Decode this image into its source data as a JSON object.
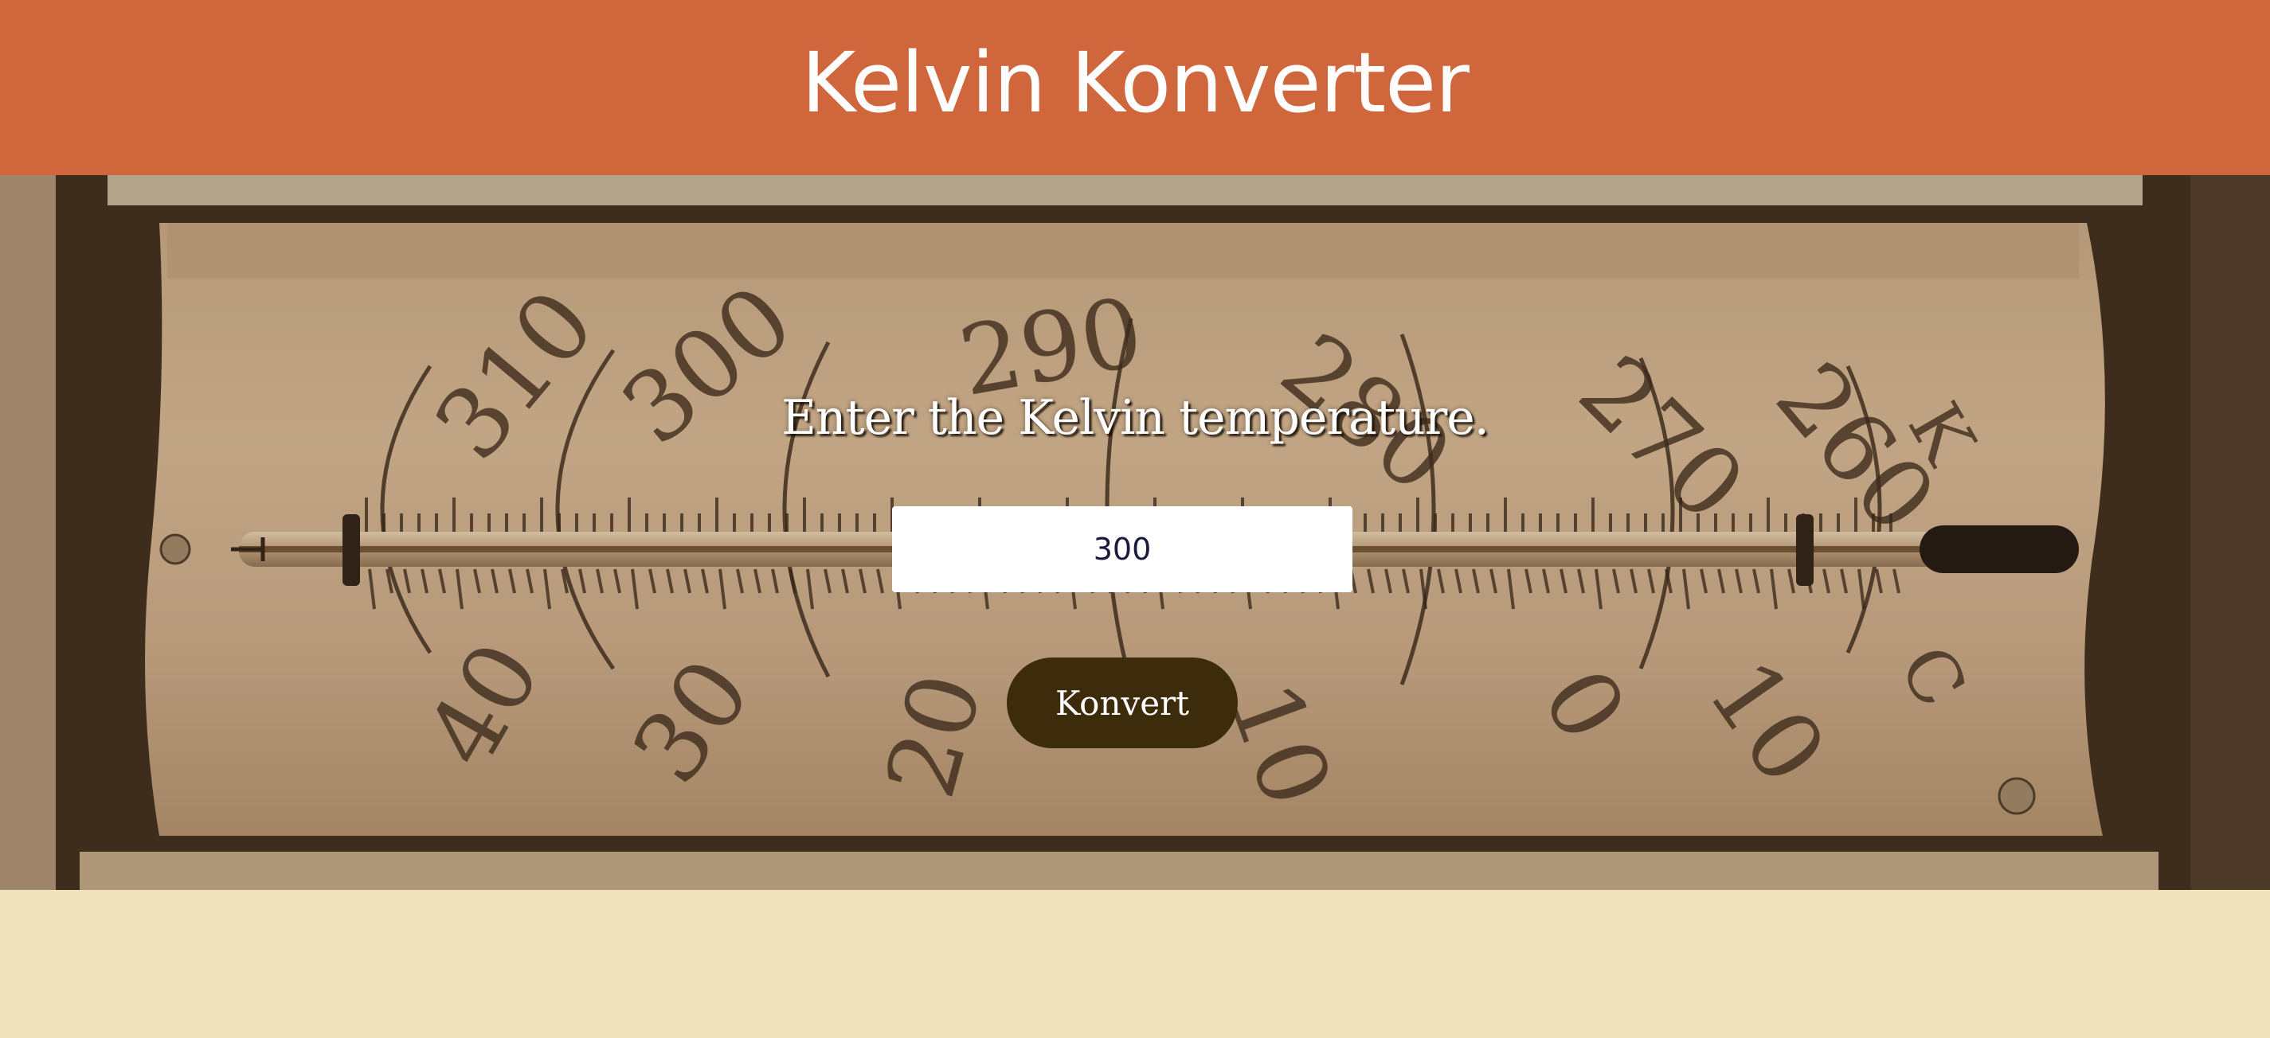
{
  "app": {
    "title": "Kelvin Konverter"
  },
  "form": {
    "prompt": "Enter the Kelvin temperature.",
    "input_value": "300",
    "button_label": "Konvert"
  },
  "thermometer_image": {
    "kelvin_labels": [
      "310",
      "300",
      "290",
      "280",
      "270",
      "260",
      "K"
    ],
    "celsius_labels": [
      "40",
      "30",
      "20",
      "10",
      "0",
      "-10",
      "C"
    ]
  },
  "colors": {
    "header_bg": "#d0663b",
    "page_bg": "#efe3bb",
    "button_bg": "#3d2c0b"
  }
}
